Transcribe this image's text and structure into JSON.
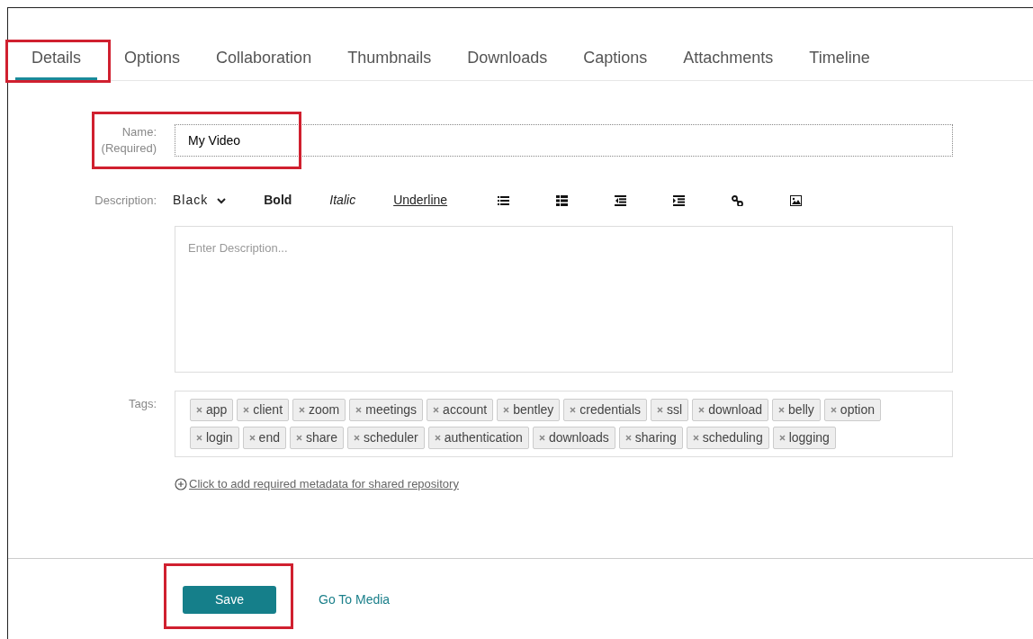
{
  "tabs": [
    {
      "label": "Details",
      "selected": true,
      "highlighted": true
    },
    {
      "label": "Options",
      "selected": false,
      "highlighted": false
    },
    {
      "label": "Collaboration",
      "selected": false,
      "highlighted": false
    },
    {
      "label": "Thumbnails",
      "selected": false,
      "highlighted": false
    },
    {
      "label": "Downloads",
      "selected": false,
      "highlighted": false
    },
    {
      "label": "Captions",
      "selected": false,
      "highlighted": false
    },
    {
      "label": "Attachments",
      "selected": false,
      "highlighted": false
    },
    {
      "label": "Timeline",
      "selected": false,
      "highlighted": false
    }
  ],
  "name_field": {
    "label": "Name:",
    "sublabel": "(Required)",
    "value": "My Video",
    "highlighted": true
  },
  "description": {
    "label": "Description:",
    "toolbar": [
      {
        "kind": "dropdown",
        "text": "Black"
      },
      {
        "kind": "bold",
        "text": "Bold"
      },
      {
        "kind": "italic",
        "text": "Italic"
      },
      {
        "kind": "underline",
        "text": "Underline"
      }
    ],
    "placeholder": "Enter Description..."
  },
  "tags": {
    "label": "Tags:",
    "items": [
      "app",
      "client",
      "zoom",
      "meetings",
      "account",
      "bentley",
      "credentials",
      "ssl",
      "download",
      "belly",
      "option",
      "login",
      "end",
      "share",
      "scheduler",
      "authentication",
      "downloads",
      "sharing",
      "scheduling",
      "logging"
    ]
  },
  "metadata_link": "Click to add required metadata for shared repository",
  "save_button": {
    "label": "Save",
    "highlighted": true
  },
  "go_to_media": "Go To Media"
}
